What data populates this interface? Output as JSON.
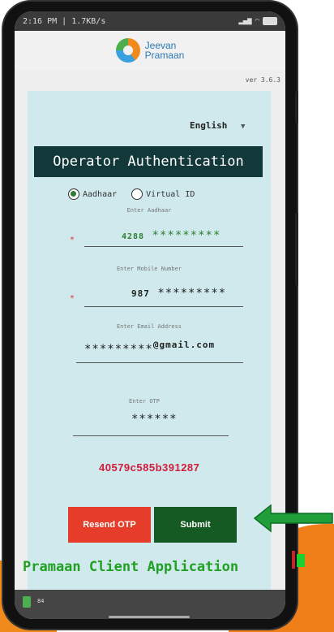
{
  "status_bar": {
    "time_speed": "2:16 PM | 1.7KB/s",
    "icons": "signal wifi battery"
  },
  "app": {
    "brand_line1": "Jeevan",
    "brand_line2": "Pramaan",
    "version": "ver 3.6.3"
  },
  "language": {
    "selected": "English"
  },
  "auth": {
    "title": "Operator Authentication",
    "radio_aadhaar": "Aadhaar",
    "radio_virtual_id": "Virtual ID",
    "selected": "Aadhaar"
  },
  "fields": {
    "aadhaar_label": "Enter Aadhaar",
    "aadhaar_value_prefix": "4288",
    "aadhaar_value_mask": "*********",
    "mobile_label": "Enter Mobile Number",
    "mobile_value_prefix": "987",
    "mobile_value_mask": "*********",
    "email_label": "Enter Email Address",
    "email_value_mask": "*********",
    "email_value_suffix": "@gmail.com",
    "otp_label": "Enter OTP",
    "otp_value": "******"
  },
  "hash_text": "40579c585b391287",
  "buttons": {
    "resend": "Resend OTP",
    "submit": "Submit"
  },
  "footer_text": "Pramaan Client Application",
  "nav": {
    "label": "84"
  },
  "colors": {
    "banner_bg": "#123839",
    "content_bg": "#cfe9ed",
    "resend_bg": "#e53d2a",
    "submit_bg": "#155a22",
    "accent_green": "#22a022",
    "hash_red": "#d31b3a",
    "orange": "#f08a1c"
  }
}
